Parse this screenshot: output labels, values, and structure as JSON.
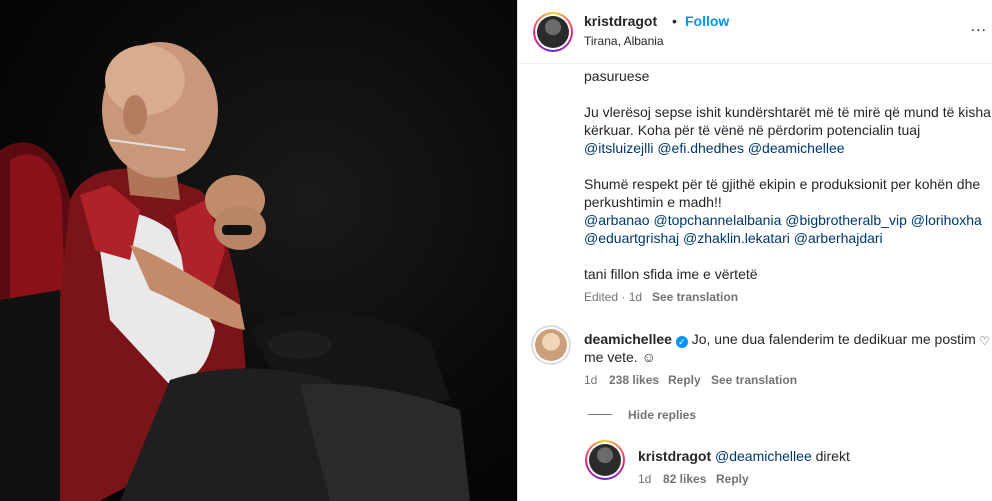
{
  "post": {
    "author": "kristdragot",
    "follow_label": "Follow",
    "separator": "•",
    "location": "Tirana, Albania",
    "more": "..."
  },
  "caption": {
    "line0": "pasuruese",
    "line1": "Ju vlerësoj sepse ishit kundërshtarët më të mirë që mund të kisha",
    "line2": "kërkuar. Koha për të vënë në përdorim potencialin tuaj",
    "mentions1": [
      "@itsluizejlli",
      "@efi.dhedhes",
      "@deamichellee"
    ],
    "line3": "Shumë respekt për të gjithë ekipin e produksionit per kohën dhe",
    "line4": "perkushtimin e madh!!",
    "mentions2": [
      "@arbanao",
      "@topchannelalbania",
      "@bigbrotheralb_vip",
      "@lorihoxha"
    ],
    "mentions3": [
      "@eduartgrishaj",
      "@zhaklin.lekatari",
      "@arberhajdari"
    ],
    "line5": "tani fillon sfida ime e vërtetë",
    "edited": "Edited · 1d",
    "see_translation": "See translation"
  },
  "comments": [
    {
      "author": "deamichellee",
      "verified": true,
      "text_line1": "Jo, une dua falenderim te dedikuar me postim",
      "text_line2": "me vete. ☺",
      "time": "1d",
      "likes": "238 likes",
      "reply": "Reply",
      "see_translation": "See translation",
      "hide_replies": "Hide replies"
    }
  ],
  "replies": [
    {
      "author": "kristdragot",
      "mention": "@deamichellee",
      "text": "direkt",
      "time": "1d",
      "likes": "82 likes",
      "reply": "Reply"
    }
  ],
  "colors": {
    "link": "#00376b",
    "follow": "#0095f6",
    "verified": "#0095f6",
    "muted": "#737373"
  },
  "icons": [
    "heart-icon",
    "verified-badge-icon",
    "more-options-icon"
  ]
}
